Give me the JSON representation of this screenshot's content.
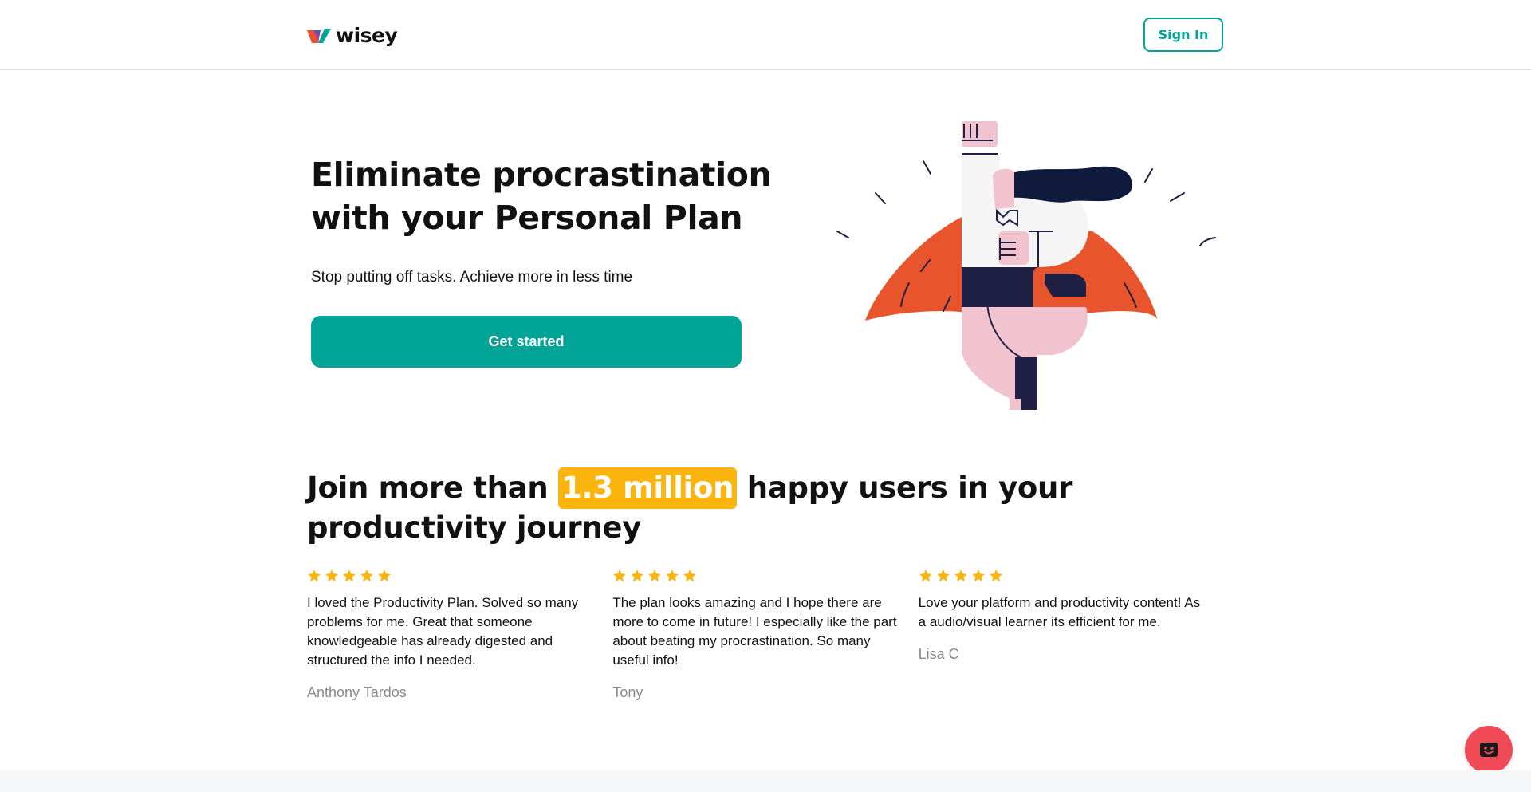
{
  "header": {
    "logo_text": "wisey",
    "signin_label": "Sign In"
  },
  "hero": {
    "title_line1": "Eliminate procrastination",
    "title_line2": "with your Personal Plan",
    "subtitle": "Stop putting off tasks. Achieve more in less time",
    "cta_label": "Get started"
  },
  "social_proof": {
    "title_prefix": "Join more than",
    "title_highlight": "1.3 million",
    "title_suffix": "happy users in your productivity journey"
  },
  "reviews": [
    {
      "rating": 5,
      "text": "I loved the Productivity Plan. Solved so many problems for me. Great that someone knowledgeable has already digested and structured the info I needed.",
      "author": "Anthony Tardos"
    },
    {
      "rating": 5,
      "text": "The plan looks amazing and I hope there are more to come in future! I especially like the part about beating my procrastination. So many useful info!",
      "author": "Tony"
    },
    {
      "rating": 5,
      "text": "Love your platform and productivity content! As a audio/visual learner its efficient for me.",
      "author": "Lisa C"
    }
  ],
  "colors": {
    "brand_teal": "#00a598",
    "highlight_yellow": "#fbb50e",
    "star_yellow": "#fbb50e",
    "chat_red": "#f04a56",
    "cape_orange": "#e8552c",
    "navy": "#1f2044",
    "pink": "#f0c3cf"
  },
  "icons": {
    "logo": "wisey-logo-icon",
    "star": "star-icon",
    "chat": "chat-face-icon"
  }
}
